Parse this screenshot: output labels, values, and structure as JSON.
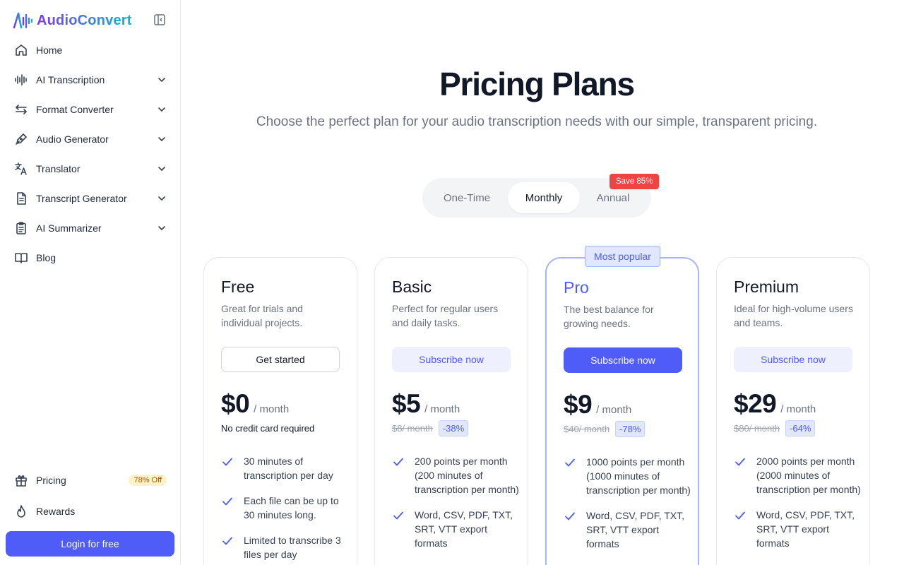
{
  "app": {
    "name": "AudioConvert"
  },
  "sidebar": {
    "items": [
      {
        "label": "Home",
        "icon": "home-icon",
        "has_chevron": false
      },
      {
        "label": "AI Transcription",
        "icon": "waveform-icon",
        "has_chevron": true
      },
      {
        "label": "Format Converter",
        "icon": "swap-arrows-icon",
        "has_chevron": true
      },
      {
        "label": "Audio Generator",
        "icon": "pen-nib-icon",
        "has_chevron": true
      },
      {
        "label": "Translator",
        "icon": "translate-icon",
        "has_chevron": true
      },
      {
        "label": "Transcript Generator",
        "icon": "document-icon",
        "has_chevron": true
      },
      {
        "label": "AI Summarizer",
        "icon": "clipboard-icon",
        "has_chevron": true
      },
      {
        "label": "Blog",
        "icon": "book-icon",
        "has_chevron": false
      }
    ],
    "bottom": {
      "pricing_label": "Pricing",
      "pricing_badge": "78% Off",
      "rewards_label": "Rewards",
      "login_label": "Login for free"
    }
  },
  "main": {
    "title": "Pricing Plans",
    "subtitle": "Choose the perfect plan for your audio transcription needs with our simple, transparent pricing.",
    "billing_toggle": {
      "options": [
        "One-Time",
        "Monthly",
        "Annual"
      ],
      "selected": "Monthly",
      "annual_badge": "Save 85%"
    },
    "popular_badge": "Most popular",
    "plans": [
      {
        "name": "Free",
        "description": "Great for trials and individual projects.",
        "cta": "Get started",
        "price": "$0",
        "period": "/ month",
        "note": "No credit card required",
        "features": [
          "30 minutes of transcription per day",
          "Each file can be up to 30 minutes long.",
          "Limited to transcribe 3 files per day"
        ]
      },
      {
        "name": "Basic",
        "description": "Perfect for regular users and daily tasks.",
        "cta": "Subscribe now",
        "price": "$5",
        "period": "/ month",
        "old_price": "$8/ month",
        "discount": "-38%",
        "features": [
          "200 points per month (200 minutes of transcription per month)",
          "Word, CSV, PDF, TXT, SRT, VTT export formats"
        ]
      },
      {
        "name": "Pro",
        "description": "The best balance for growing needs.",
        "cta": "Subscribe now",
        "price": "$9",
        "period": "/ month",
        "old_price": "$40/ month",
        "discount": "-78%",
        "features": [
          "1000 points per month (1000 minutes of transcription per month)",
          "Word, CSV, PDF, TXT, SRT, VTT export formats"
        ]
      },
      {
        "name": "Premium",
        "description": "Ideal for high-volume users and teams.",
        "cta": "Subscribe now",
        "price": "$29",
        "period": "/ month",
        "old_price": "$80/ month",
        "discount": "-64%",
        "features": [
          "2000 points per month (2000 minutes of transcription per month)",
          "Word, CSV, PDF, TXT, SRT, VTT export formats"
        ]
      }
    ]
  },
  "colors": {
    "accent": "#4f5cf7",
    "accent_soft": "#eef0fd",
    "save_badge": "#ef4444",
    "discount_badge_offer": "#fef3c7"
  }
}
